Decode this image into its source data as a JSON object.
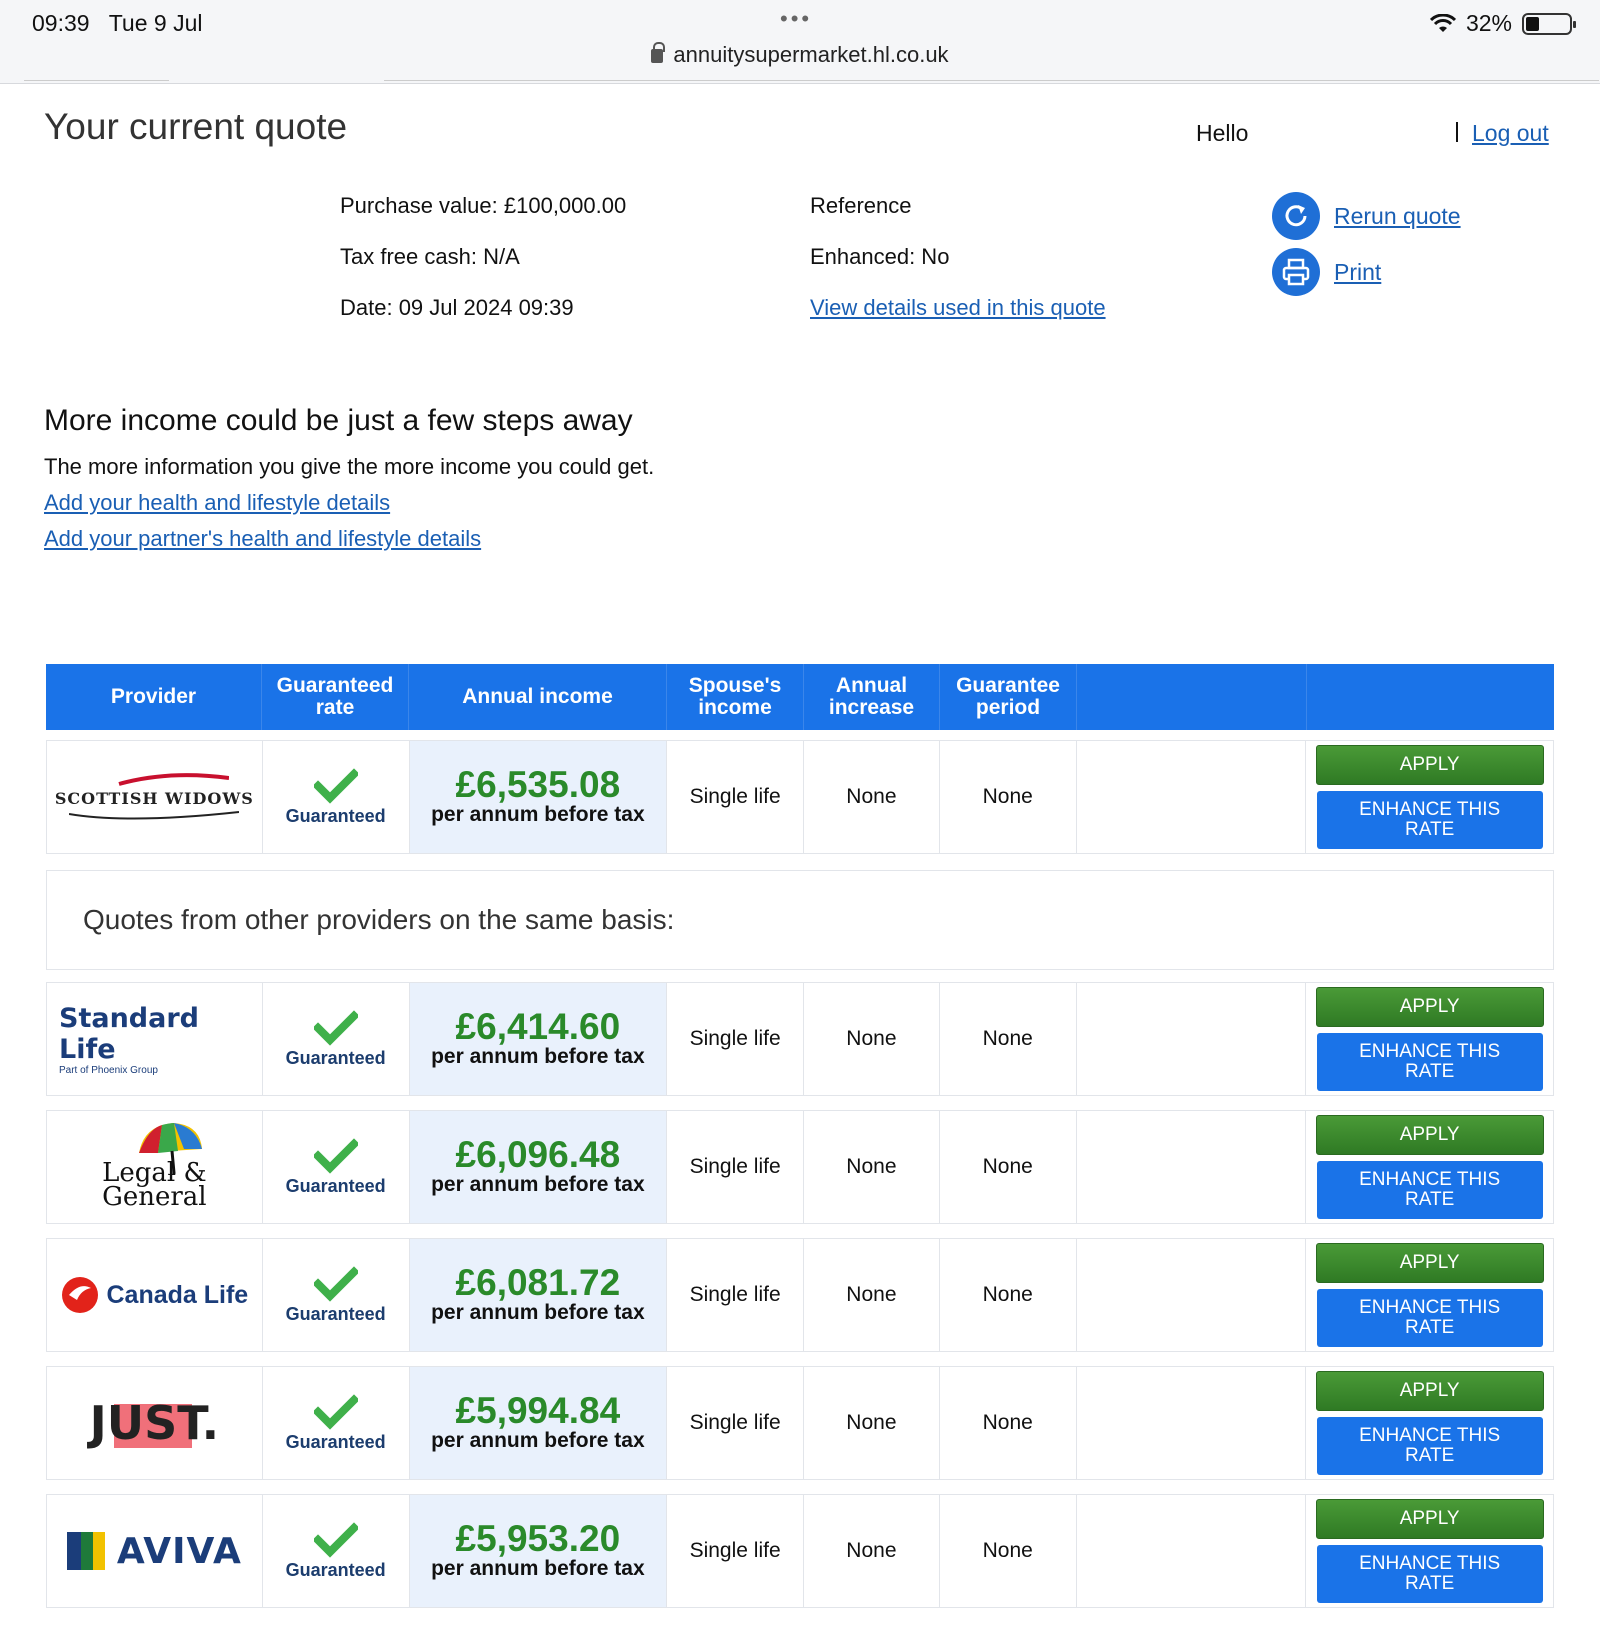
{
  "status_bar": {
    "time": "09:39",
    "date": "Tue 9 Jul",
    "battery": "32%",
    "battery_level": 0.32
  },
  "browser": {
    "url": "annuitysupermarket.hl.co.uk"
  },
  "header": {
    "title": "Your current quote",
    "hello": "Hello",
    "logout": "Log out"
  },
  "quote": {
    "purchase_value": "Purchase value: £100,000.00",
    "tax_free_cash": "Tax free cash: N/A",
    "date": "Date: 09 Jul 2024 09:39",
    "reference": "Reference",
    "enhanced": "Enhanced: No",
    "view_details": "View details used in this quote"
  },
  "actions": {
    "rerun": "Rerun quote",
    "print": "Print"
  },
  "promo": {
    "title": "More income could be just a few steps away",
    "text": "The more information you give the more income you could get.",
    "link1": "Add your health and lifestyle details",
    "link2": "Add your partner's health and lifestyle details"
  },
  "table": {
    "headers": {
      "provider": "Provider",
      "rate": "Guaranteed rate",
      "income": "Annual income",
      "spouse": "Spouse's income",
      "increase": "Annual increase",
      "period": "Guarantee period"
    },
    "other_heading": "Quotes from other providers on the same basis:",
    "guaranteed_label": "Guaranteed",
    "per_annum": "per annum before tax",
    "apply": "APPLY",
    "enhance": "ENHANCE THIS RATE",
    "rows": [
      {
        "provider": "SCOTTISH WIDOWS",
        "amount": "£6,535.08",
        "spouse": "Single life",
        "increase": "None",
        "period": "None"
      },
      {
        "provider": "Standard Life",
        "provider_sub": "Part of Phoenix Group",
        "amount": "£6,414.60",
        "spouse": "Single life",
        "increase": "None",
        "period": "None"
      },
      {
        "provider": "Legal & General",
        "amount": "£6,096.48",
        "spouse": "Single life",
        "increase": "None",
        "period": "None"
      },
      {
        "provider": "Canada Life",
        "amount": "£6,081.72",
        "spouse": "Single life",
        "increase": "None",
        "period": "None"
      },
      {
        "provider": "JUST.",
        "amount": "£5,994.84",
        "spouse": "Single life",
        "increase": "None",
        "period": "None"
      },
      {
        "provider": "AVIVA",
        "amount": "£5,953.20",
        "spouse": "Single life",
        "increase": "None",
        "period": "None"
      }
    ]
  },
  "colors": {
    "header_blue": "#1a73e8",
    "amount_green": "#2a8a2a",
    "apply_green": "#3d8a2e",
    "link_blue": "#1a5fb4"
  }
}
